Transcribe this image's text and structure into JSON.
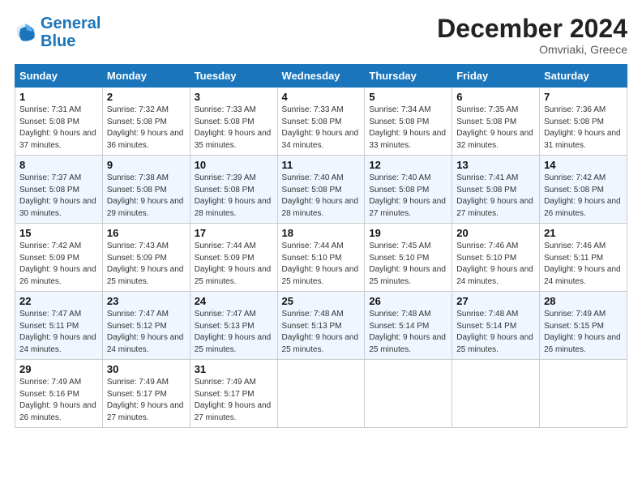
{
  "logo": {
    "line1": "General",
    "line2": "Blue"
  },
  "header": {
    "month": "December 2024",
    "location": "Omvriaki, Greece"
  },
  "weekdays": [
    "Sunday",
    "Monday",
    "Tuesday",
    "Wednesday",
    "Thursday",
    "Friday",
    "Saturday"
  ],
  "weeks": [
    [
      {
        "day": "1",
        "sunrise": "7:31 AM",
        "sunset": "5:08 PM",
        "daylight": "9 hours and 37 minutes."
      },
      {
        "day": "2",
        "sunrise": "7:32 AM",
        "sunset": "5:08 PM",
        "daylight": "9 hours and 36 minutes."
      },
      {
        "day": "3",
        "sunrise": "7:33 AM",
        "sunset": "5:08 PM",
        "daylight": "9 hours and 35 minutes."
      },
      {
        "day": "4",
        "sunrise": "7:33 AM",
        "sunset": "5:08 PM",
        "daylight": "9 hours and 34 minutes."
      },
      {
        "day": "5",
        "sunrise": "7:34 AM",
        "sunset": "5:08 PM",
        "daylight": "9 hours and 33 minutes."
      },
      {
        "day": "6",
        "sunrise": "7:35 AM",
        "sunset": "5:08 PM",
        "daylight": "9 hours and 32 minutes."
      },
      {
        "day": "7",
        "sunrise": "7:36 AM",
        "sunset": "5:08 PM",
        "daylight": "9 hours and 31 minutes."
      }
    ],
    [
      {
        "day": "8",
        "sunrise": "7:37 AM",
        "sunset": "5:08 PM",
        "daylight": "9 hours and 30 minutes."
      },
      {
        "day": "9",
        "sunrise": "7:38 AM",
        "sunset": "5:08 PM",
        "daylight": "9 hours and 29 minutes."
      },
      {
        "day": "10",
        "sunrise": "7:39 AM",
        "sunset": "5:08 PM",
        "daylight": "9 hours and 28 minutes."
      },
      {
        "day": "11",
        "sunrise": "7:40 AM",
        "sunset": "5:08 PM",
        "daylight": "9 hours and 28 minutes."
      },
      {
        "day": "12",
        "sunrise": "7:40 AM",
        "sunset": "5:08 PM",
        "daylight": "9 hours and 27 minutes."
      },
      {
        "day": "13",
        "sunrise": "7:41 AM",
        "sunset": "5:08 PM",
        "daylight": "9 hours and 27 minutes."
      },
      {
        "day": "14",
        "sunrise": "7:42 AM",
        "sunset": "5:08 PM",
        "daylight": "9 hours and 26 minutes."
      }
    ],
    [
      {
        "day": "15",
        "sunrise": "7:42 AM",
        "sunset": "5:09 PM",
        "daylight": "9 hours and 26 minutes."
      },
      {
        "day": "16",
        "sunrise": "7:43 AM",
        "sunset": "5:09 PM",
        "daylight": "9 hours and 25 minutes."
      },
      {
        "day": "17",
        "sunrise": "7:44 AM",
        "sunset": "5:09 PM",
        "daylight": "9 hours and 25 minutes."
      },
      {
        "day": "18",
        "sunrise": "7:44 AM",
        "sunset": "5:10 PM",
        "daylight": "9 hours and 25 minutes."
      },
      {
        "day": "19",
        "sunrise": "7:45 AM",
        "sunset": "5:10 PM",
        "daylight": "9 hours and 25 minutes."
      },
      {
        "day": "20",
        "sunrise": "7:46 AM",
        "sunset": "5:10 PM",
        "daylight": "9 hours and 24 minutes."
      },
      {
        "day": "21",
        "sunrise": "7:46 AM",
        "sunset": "5:11 PM",
        "daylight": "9 hours and 24 minutes."
      }
    ],
    [
      {
        "day": "22",
        "sunrise": "7:47 AM",
        "sunset": "5:11 PM",
        "daylight": "9 hours and 24 minutes."
      },
      {
        "day": "23",
        "sunrise": "7:47 AM",
        "sunset": "5:12 PM",
        "daylight": "9 hours and 24 minutes."
      },
      {
        "day": "24",
        "sunrise": "7:47 AM",
        "sunset": "5:13 PM",
        "daylight": "9 hours and 25 minutes."
      },
      {
        "day": "25",
        "sunrise": "7:48 AM",
        "sunset": "5:13 PM",
        "daylight": "9 hours and 25 minutes."
      },
      {
        "day": "26",
        "sunrise": "7:48 AM",
        "sunset": "5:14 PM",
        "daylight": "9 hours and 25 minutes."
      },
      {
        "day": "27",
        "sunrise": "7:48 AM",
        "sunset": "5:14 PM",
        "daylight": "9 hours and 25 minutes."
      },
      {
        "day": "28",
        "sunrise": "7:49 AM",
        "sunset": "5:15 PM",
        "daylight": "9 hours and 26 minutes."
      }
    ],
    [
      {
        "day": "29",
        "sunrise": "7:49 AM",
        "sunset": "5:16 PM",
        "daylight": "9 hours and 26 minutes."
      },
      {
        "day": "30",
        "sunrise": "7:49 AM",
        "sunset": "5:17 PM",
        "daylight": "9 hours and 27 minutes."
      },
      {
        "day": "31",
        "sunrise": "7:49 AM",
        "sunset": "5:17 PM",
        "daylight": "9 hours and 27 minutes."
      },
      null,
      null,
      null,
      null
    ]
  ]
}
